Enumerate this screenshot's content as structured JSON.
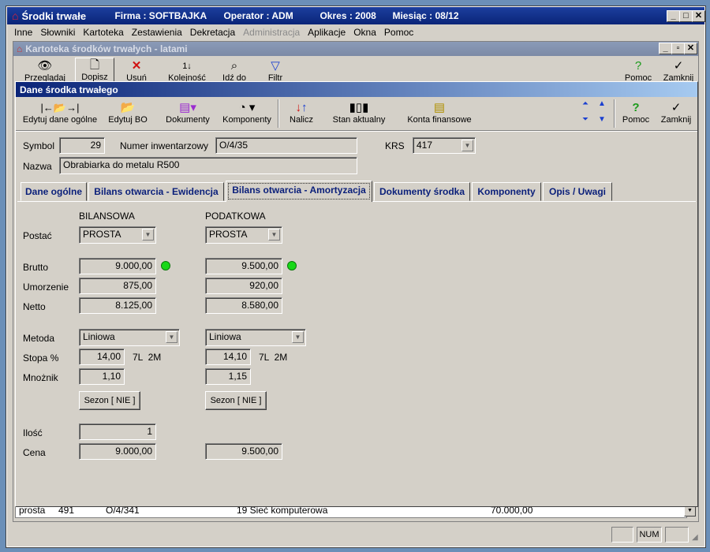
{
  "app": {
    "title": "Środki trwałe",
    "firma": "Firma : SOFTBAJKA",
    "operator": "Operator : ADM",
    "okres": "Okres : 2008",
    "miesiac": "Miesiąc : 08/12"
  },
  "menu": [
    "Inne",
    "Słowniki",
    "Kartoteka",
    "Zestawienia",
    "Dekretacja",
    "Administracja",
    "Aplikacje",
    "Okna",
    "Pomoc"
  ],
  "kartoteka": {
    "title": "Kartoteka środków trwałych - latami",
    "toolbar": [
      "Przeglądaj",
      "Dopisz",
      "Usuń",
      "Kolejność",
      "Idź do",
      "Filtr"
    ],
    "toolbar_right": [
      "Pomoc",
      "Zamknij"
    ],
    "bottom_row": [
      "prosta",
      "491",
      "O/4/341",
      "19 Sieć komputerowa",
      "70.000,00"
    ]
  },
  "dialog": {
    "title": "Dane środka trwałego",
    "toolbar": [
      {
        "label": "Edytuj dane ogólne",
        "icon": "edit-general-icon"
      },
      {
        "label": "Edytuj BO",
        "icon": "folder-open-icon"
      },
      {
        "label": "Dokumenty",
        "icon": "documents-icon"
      },
      {
        "label": "Komponenty",
        "icon": "components-icon"
      },
      {
        "label": "Nalicz",
        "icon": "calculate-arrows-icon"
      },
      {
        "label": "Stan aktualny",
        "icon": "bar-chart-icon"
      },
      {
        "label": "Konta finansowe",
        "icon": "ledger-icon"
      }
    ],
    "toolbar_right": [
      "Pomoc",
      "Zamknij"
    ],
    "header": {
      "symbol_label": "Symbol",
      "symbol_value": "29",
      "inv_label": "Numer inwentarzowy",
      "inv_value": "O/4/35",
      "krs_label": "KRS",
      "krs_value": "417",
      "nazwa_label": "Nazwa",
      "nazwa_value": "Obrabiarka do metalu R500"
    },
    "tabs": [
      "Dane ogólne",
      "Bilans otwarcia - Ewidencja",
      "Bilans otwarcia - Amortyzacja",
      "Dokumenty środka",
      "Komponenty",
      "Opis / Uwagi"
    ],
    "active_tab": 2,
    "form": {
      "col_bilansowa": "BILANSOWA",
      "col_podatkowa": "PODATKOWA",
      "postac_label": "Postać",
      "brutto_label": "Brutto",
      "umorzenie_label": "Umorzenie",
      "netto_label": "Netto",
      "metoda_label": "Metoda",
      "stopa_label": "Stopa %",
      "mnoznik_label": "Mnożnik",
      "ilosc_label": "Ilość",
      "cena_label": "Cena",
      "bil": {
        "postac": "PROSTA",
        "brutto": "9.000,00",
        "umorzenie": "875,00",
        "netto": "8.125,00",
        "metoda": "Liniowa",
        "stopa": "14,00",
        "stopa_suffix": "7L  2M",
        "mnoznik": "1,10",
        "sezon": "Sezon [ NIE ]",
        "ilosc": "1",
        "cena": "9.000,00"
      },
      "pod": {
        "postac": "PROSTA",
        "brutto": "9.500,00",
        "umorzenie": "920,00",
        "netto": "8.580,00",
        "metoda": "Liniowa",
        "stopa": "14,10",
        "stopa_suffix": "7L  2M",
        "mnoznik": "1,15",
        "sezon": "Sezon [ NIE ]",
        "cena": "9.500,00"
      }
    }
  },
  "statusbar": {
    "num": "NUM"
  },
  "colors": {
    "titlebar": "#0a2478",
    "tab_text": "#0a1f7a",
    "face": "#d4d0c8",
    "status_dot": "#18d818"
  }
}
